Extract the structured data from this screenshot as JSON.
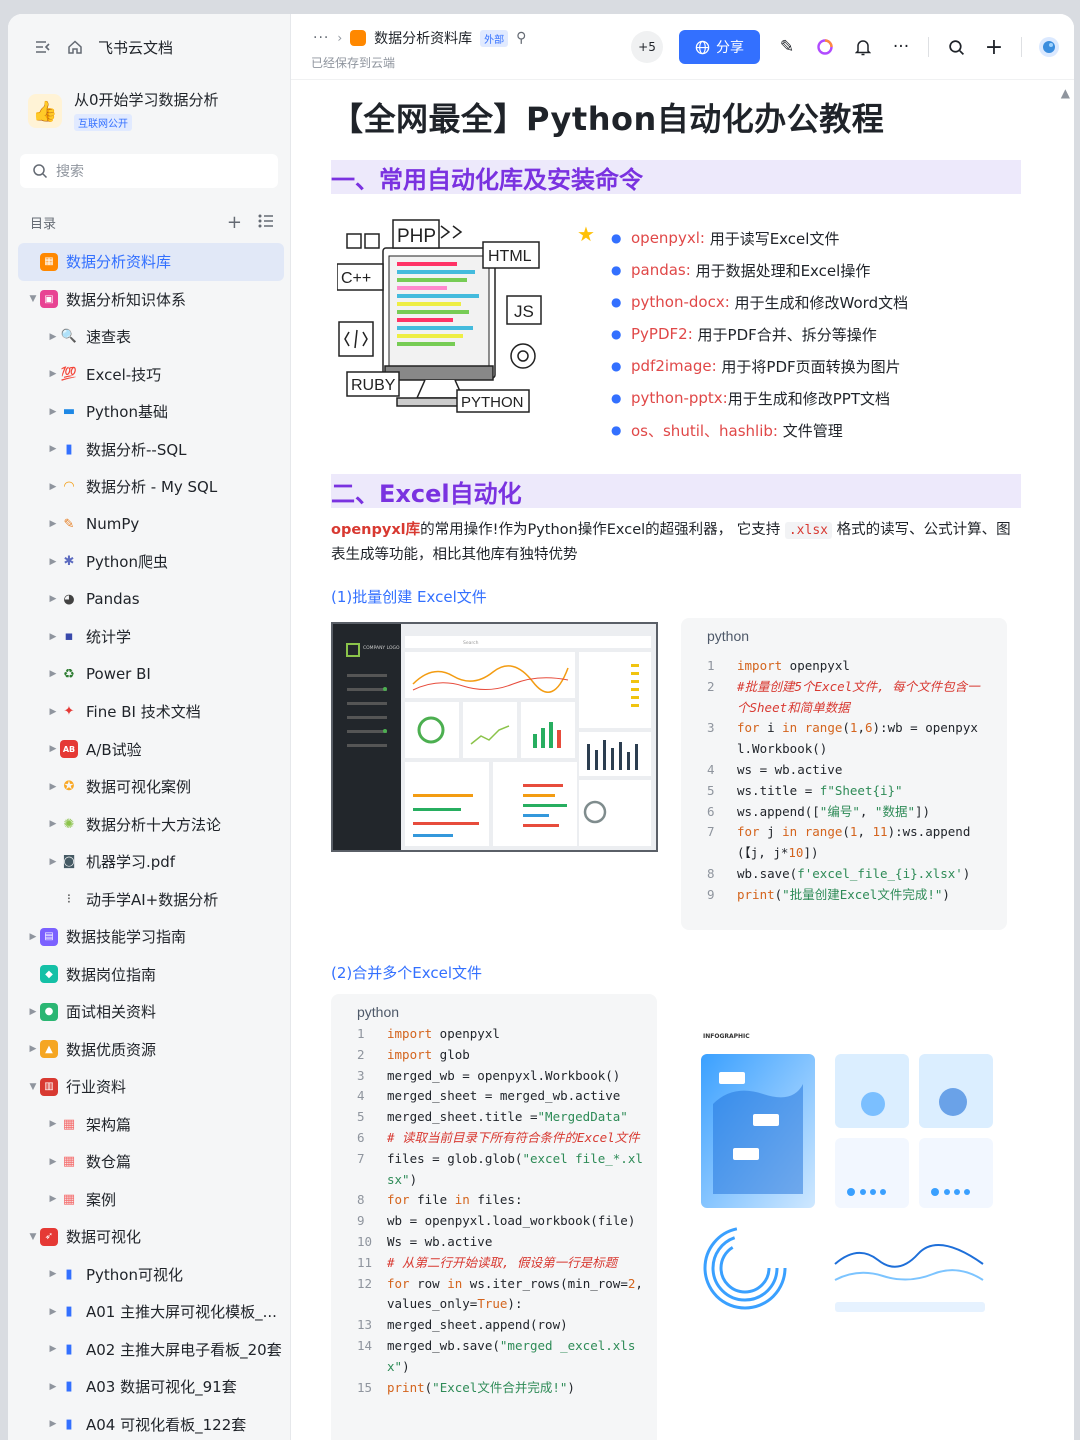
{
  "sidebar": {
    "top_title": "飞书云文档",
    "workspace": {
      "title": "从0开始学习数据分析",
      "badge": "互联网公开"
    },
    "search_placeholder": "搜索",
    "toc_label": "目录",
    "items": [
      {
        "label": "数据分析资料库",
        "level": 0,
        "caret": "",
        "icon": "folder-icon",
        "color": "#ff8800",
        "active": true
      },
      {
        "label": "数据分析知识体系",
        "level": 0,
        "caret": "▼",
        "icon": "board-icon",
        "color": "#e84393"
      },
      {
        "label": "速查表",
        "level": 1,
        "caret": "▶",
        "icon": "search-icon",
        "color": "#1e6fd9"
      },
      {
        "label": "Excel-技巧",
        "level": 1,
        "caret": "▶",
        "icon": "hundred-icon",
        "color": "#e53935"
      },
      {
        "label": "Python基础",
        "level": 1,
        "caret": "▶",
        "icon": "monitor-icon",
        "color": "#1e88e5"
      },
      {
        "label": "数据分析--SQL",
        "level": 1,
        "caret": "▶",
        "icon": "bar-chart-icon",
        "color": "#3370ff"
      },
      {
        "label": "数据分析 - My SQL",
        "level": 1,
        "caret": "▶",
        "icon": "rainbow-icon",
        "color": "#f39c12"
      },
      {
        "label": "NumPy",
        "level": 1,
        "caret": "▶",
        "icon": "memo-icon",
        "color": "#e67e22"
      },
      {
        "label": "Python爬虫",
        "level": 1,
        "caret": "▶",
        "icon": "spider-icon",
        "color": "#5c6bc0"
      },
      {
        "label": "Pandas",
        "level": 1,
        "caret": "▶",
        "icon": "panda-icon",
        "color": "#424242"
      },
      {
        "label": "统计学",
        "level": 1,
        "caret": "▶",
        "icon": "floppy-icon",
        "color": "#3949ab"
      },
      {
        "label": "Power BI",
        "level": 1,
        "caret": "▶",
        "icon": "recycle-icon",
        "color": "#2e7d32"
      },
      {
        "label": "Fine BI 技术文档",
        "level": 1,
        "caret": "▶",
        "icon": "pin-icon",
        "color": "#e53935"
      },
      {
        "label": "A/B试验",
        "level": 1,
        "caret": "▶",
        "icon": "ab-icon",
        "color": "#e53935"
      },
      {
        "label": "数据可视化案例",
        "level": 1,
        "caret": "▶",
        "icon": "medal-icon",
        "color": "#f9a825"
      },
      {
        "label": "数据分析十大方法论",
        "level": 1,
        "caret": "▶",
        "icon": "sparkle-icon",
        "color": "#8bc34a"
      },
      {
        "label": "机器学习.pdf",
        "level": 1,
        "caret": "▶",
        "icon": "robot-icon",
        "color": "#455a64"
      },
      {
        "label": "动手学AI+数据分析",
        "level": 1,
        "caret": "",
        "icon": "traffic-light-icon",
        "color": "#424242"
      },
      {
        "label": "数据技能学习指南",
        "level": 0,
        "caret": "▶",
        "icon": "book-icon",
        "color": "#7b61ff"
      },
      {
        "label": "数据岗位指南",
        "level": 0,
        "caret": "",
        "icon": "diamond-icon",
        "color": "#14c0a6"
      },
      {
        "label": "面试相关资料",
        "level": 0,
        "caret": "▶",
        "icon": "chat-icon",
        "color": "#2bb673"
      },
      {
        "label": "数据优质资源",
        "level": 0,
        "caret": "▶",
        "icon": "thumb-icon",
        "color": "#f5a623"
      },
      {
        "label": "行业资料",
        "level": 0,
        "caret": "▼",
        "icon": "doc-icon",
        "color": "#d83931"
      },
      {
        "label": "架构篇",
        "level": 1,
        "caret": "▶",
        "icon": "grid-icon",
        "color": "#f56c6c"
      },
      {
        "label": "数仓篇",
        "level": 1,
        "caret": "▶",
        "icon": "grid-icon",
        "color": "#f56c6c"
      },
      {
        "label": "案例",
        "level": 1,
        "caret": "▶",
        "icon": "grid-icon",
        "color": "#f56c6c"
      },
      {
        "label": "数据可视化",
        "level": 0,
        "caret": "▼",
        "icon": "rocket-icon",
        "color": "#e53935"
      },
      {
        "label": "Python可视化",
        "level": 1,
        "caret": "▶",
        "icon": "bar-chart-icon",
        "color": "#3370ff"
      },
      {
        "label": "A01 主推大屏可视化模板_...",
        "level": 1,
        "caret": "▶",
        "icon": "bar-chart-icon",
        "color": "#3370ff"
      },
      {
        "label": "A02 主推大屏电子看板_20套",
        "level": 1,
        "caret": "▶",
        "icon": "bar-chart-icon",
        "color": "#3370ff"
      },
      {
        "label": "A03 数据可视化_91套",
        "level": 1,
        "caret": "▶",
        "icon": "bar-chart-icon",
        "color": "#3370ff"
      },
      {
        "label": "A04 可视化看板_122套",
        "level": 1,
        "caret": "▶",
        "icon": "bar-chart-icon",
        "color": "#3370ff"
      }
    ]
  },
  "topbar": {
    "dots": "···",
    "crumb_title": "数据分析资料库",
    "external_tag": "外部",
    "saved_text": "已经保存到云端",
    "collaborators": "+5",
    "share_label": "分享"
  },
  "doc": {
    "title": "【全网最全】Python自动化办公教程",
    "section1": "一、常用自动化库及安装命令",
    "lang_icons": {
      "php": "PHP",
      "html": "HTML",
      "cpp": "C++",
      "js": "JS",
      "ruby": "RUBY",
      "python": "PYTHON"
    },
    "libs": [
      {
        "name": "openpyxl:",
        "desc": " 用于读写Excel文件"
      },
      {
        "name": "pandas:",
        "desc": " 用于数据处理和Excel操作"
      },
      {
        "name": "python-docx:",
        "desc": " 用于生成和修改Word文档"
      },
      {
        "name": "PyPDF2:",
        "desc": " 用于PDF合并、拆分等操作"
      },
      {
        "name": "pdf2image:",
        "desc": " 用于将PDF页面转换为图片"
      },
      {
        "name": "python-pptx:",
        "desc": "用于生成和修改PPT文档"
      },
      {
        "name": "os、shutil、hashlib:",
        "desc": " 文件管理"
      }
    ],
    "section2": "二、Excel自动化",
    "intro_red": "openpyxl库",
    "intro_1": "的常用操作!作为Python操作Excel的超强利器， 它支持",
    "intro_code": ".xlsx",
    "intro_2": "格式的读写、公式计算、图表生成等功能，相比其他库有独特优势",
    "sub1": "(1)批量创建 Excel文件",
    "sub2": "(2)合并多个Excel文件",
    "code_lang": "python",
    "dashboard_logo": "COMPANY LOGO",
    "dashboard_search": "Search",
    "infographic_label": "INFOGRAPHIC"
  }
}
